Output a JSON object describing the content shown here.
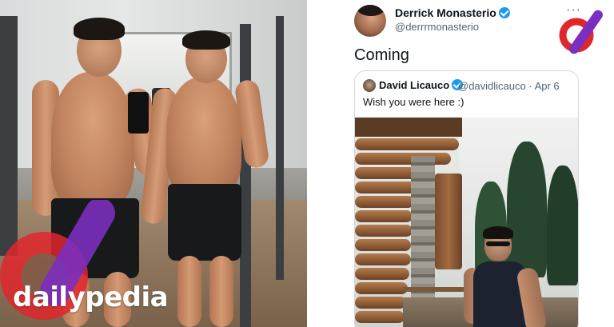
{
  "watermark": {
    "brand": "dailypedia",
    "accent_colors": [
      "#7b2fbf",
      "#e0262d"
    ]
  },
  "tweet": {
    "author": {
      "display_name": "Derrick Monasterio",
      "handle": "@derrrmonasterio",
      "verified": true
    },
    "more_label": "···",
    "text": "Coming",
    "quoted": {
      "author": {
        "display_name": "David Licauco",
        "handle": "@davidlicauco · Apr 6",
        "verified": true
      },
      "text": "Wish you were here :)"
    }
  },
  "colors": {
    "verified_blue": "#1d9bf0",
    "text_primary": "#0f1419",
    "text_secondary": "#536471",
    "border": "#cfd9de"
  }
}
